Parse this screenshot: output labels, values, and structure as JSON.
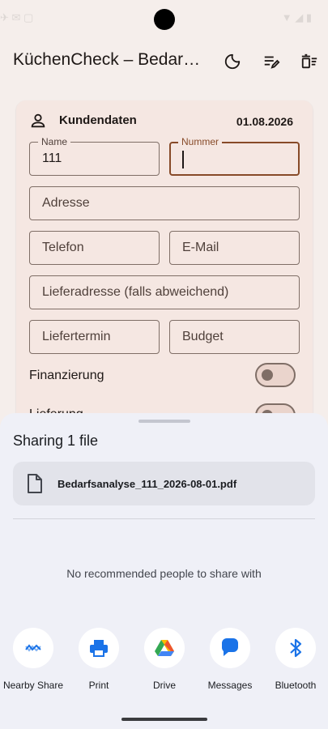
{
  "app": {
    "title": "KüchenCheck – Bedarfsanalyse",
    "actions": [
      "dark-mode-icon",
      "edit-list-icon",
      "clear-all-icon"
    ]
  },
  "customer_card": {
    "title": "Kundendaten",
    "date": "01.08.2026",
    "name": {
      "label": "Name",
      "value": "111"
    },
    "number": {
      "label": "Nummer",
      "value": ""
    },
    "address": {
      "placeholder": "Adresse"
    },
    "phone": {
      "placeholder": "Telefon"
    },
    "email": {
      "placeholder": "E-Mail"
    },
    "delivery_address": {
      "placeholder": "Lieferadresse (falls abweichend)"
    },
    "delivery_date": {
      "placeholder": "Liefertermin"
    },
    "budget": {
      "placeholder": "Budget"
    },
    "toggles": [
      {
        "label": "Finanzierung",
        "on": false
      },
      {
        "label": "Lieferung",
        "on": false
      }
    ]
  },
  "share_sheet": {
    "title": "Sharing 1 file",
    "file_name": "Bedarfsanalyse_111_2026-08-01.pdf",
    "no_people": "No recommended people to share with",
    "targets": [
      {
        "label": "Nearby Share",
        "icon": "nearby-share-icon",
        "color": "#1a73e8"
      },
      {
        "label": "Print",
        "icon": "print-icon",
        "color": "#1a73e8"
      },
      {
        "label": "Drive",
        "icon": "drive-icon",
        "color": "#34a853"
      },
      {
        "label": "Messages",
        "icon": "messages-icon",
        "color": "#1a73e8"
      },
      {
        "label": "Bluetooth",
        "icon": "bluetooth-icon",
        "color": "#1a73e8"
      }
    ]
  },
  "colors": {
    "accent": "#8d4e2a",
    "outline": "#85736b",
    "card": "#fff1ec",
    "sheet": "#eff0f7"
  }
}
